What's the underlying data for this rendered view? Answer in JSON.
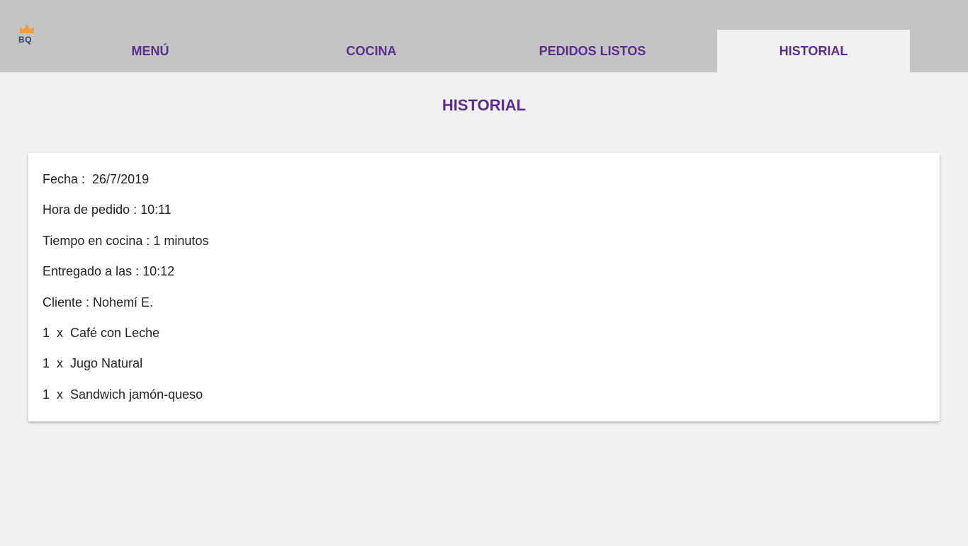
{
  "logo": {
    "text": "BQ",
    "icon": "crown-icon",
    "crown_color": "#f0a040",
    "text_color": "#2f3f66"
  },
  "nav": {
    "tabs": [
      {
        "label": "MENÚ",
        "active": false
      },
      {
        "label": "COCINA",
        "active": false
      },
      {
        "label": "PEDIDOS LISTOS",
        "active": false
      },
      {
        "label": "HISTORIAL",
        "active": true
      }
    ],
    "accent_color": "#5b2d8e",
    "bar_color": "#c4c4c4"
  },
  "main": {
    "title": "HISTORIAL"
  },
  "order": {
    "fecha": "Fecha :  26/7/2019",
    "hora": "Hora de pedido : 10:11",
    "tiempo": "Tiempo en cocina : 1 minutos",
    "entregado": "Entregado a las : 10:12",
    "cliente": "Cliente : Nohemí E.",
    "items": [
      "1  x  Café con Leche",
      "1  x  Jugo Natural",
      "1  x  Sandwich jamón-queso"
    ]
  }
}
